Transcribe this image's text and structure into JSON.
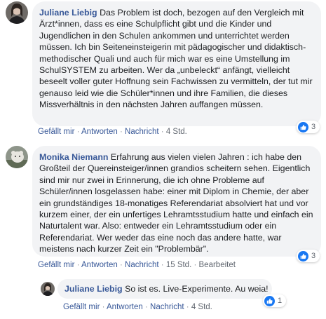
{
  "colors": {
    "author": "#385898",
    "bubble": "#f2f3f5",
    "like": "#1877f2"
  },
  "comments": [
    {
      "author": "Juliane Liebig",
      "text": "Das Problem ist doch, bezogen auf den Vergleich mit Ärzt*innen, dass es eine Schulpflicht gibt und die Kinder und Jugendlichen in den Schulen ankommen und unterrichtet werden müssen. Ich bin Seiteneinsteigerin mit pädagogischer und didaktisch-methodischer Quali und auch für mich war es eine Umstellung im SchulSYSTEM zu arbeiten. Wer da „unbeleckt“ anfängt, vielleicht beseelt voller guter Hoffnung sein Fachwissen zu vermitteln, der tut mir genauso leid wie die Schüler*innen und ihre Familien, die dieses Missverhältnis in den nächsten Jahren auffangen müssen.",
      "actions": {
        "like": "Gefällt mir",
        "reply": "Antworten",
        "message": "Nachricht",
        "time": "4 Std."
      },
      "reactions": {
        "icon": "like-icon",
        "count": "3"
      }
    },
    {
      "author": "Monika Niemann",
      "text": "Erfahrung aus vielen vielen Jahren : ich habe den Großteil der Quereinsteiger/innen grandios scheitern sehen. Eigentlich sind mir nur zwei in Erinnerung, die ich ohne Probleme auf Schüler/innen losgelassen habe: einer mit Diplom in Chemie, der aber ein grundständiges 18-monatiges Referendariat absolviert hat und vor kurzem einer, der ein unfertiges Lehramtsstudium hatte und einfach ein Naturtalent war. Also: entweder ein Lehramtsstudium oder ein Referendariat. Wer weder das eine noch das andere hatte, war meistens nach kurzer Zeit ein \"Problembär\".",
      "actions": {
        "like": "Gefällt mir",
        "reply": "Antworten",
        "message": "Nachricht",
        "time": "15 Std.",
        "edited": "Bearbeitet"
      },
      "reactions": {
        "icon": "like-icon",
        "count": "3"
      }
    },
    {
      "author": "Juliane Liebig",
      "text": "So ist es. Live-Experimente. Au weia!",
      "actions": {
        "like": "Gefällt mir",
        "reply": "Antworten",
        "message": "Nachricht",
        "time": "4 Std."
      },
      "reactions": {
        "icon": "like-icon",
        "count": "1"
      }
    }
  ]
}
